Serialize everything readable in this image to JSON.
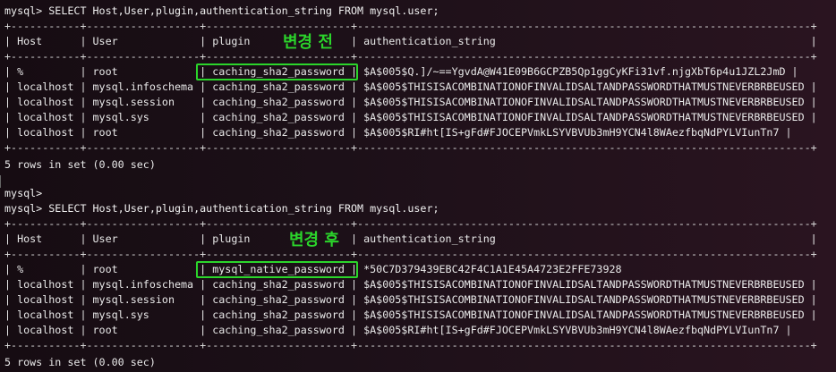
{
  "session1": {
    "query": "mysql> SELECT Host,User,plugin,authentication_string FROM mysql.user;",
    "border": "+-----------+------------------+-----------------------+------------------------------------------------------------------------+",
    "header": "| Host      | User             | plugin                | authentication_string                                                  |",
    "rows": [
      "| %         | root             | caching_sha2_password | $A$005$Q.]/~==YgvdA@W41E09B6GCPZB5Qp1ggCyKFi31vf.njgXbT6p4u1JZL2JmD |",
      "| localhost | mysql.infoschema | caching_sha2_password | $A$005$THISISACOMBINATIONOFINVALIDSALTANDPASSWORDTHATMUSTNEVERBRBEUSED |",
      "| localhost | mysql.session    | caching_sha2_password | $A$005$THISISACOMBINATIONOFINVALIDSALTANDPASSWORDTHATMUSTNEVERBRBEUSED |",
      "| localhost | mysql.sys        | caching_sha2_password | $A$005$THISISACOMBINATIONOFINVALIDSALTANDPASSWORDTHATMUSTNEVERBRBEUSED |",
      "| localhost | root             | caching_sha2_password | $A$005$RI#ht[IS+gFd#FJOCEPVmkLSYVBVUb3mH9YCN4l8WAezfbqNdPYLVIunTn7 |"
    ],
    "summary": "5 rows in set (0.00 sec)",
    "annotation": "변경 전"
  },
  "blank_prompt": "mysql>",
  "session2": {
    "query": "mysql> SELECT Host,User,plugin,authentication_string FROM mysql.user;",
    "border": "+-----------+------------------+-----------------------+------------------------------------------------------------------------+",
    "header": "| Host      | User             | plugin                | authentication_string                                                  |",
    "rows": [
      "| %         | root             | mysql_native_password | *50C7D379439EBC42F4C1A1E45A4723E2FFE73928",
      "| localhost | mysql.infoschema | caching_sha2_password | $A$005$THISISACOMBINATIONOFINVALIDSALTANDPASSWORDTHATMUSTNEVERBRBEUSED |",
      "| localhost | mysql.session    | caching_sha2_password | $A$005$THISISACOMBINATIONOFINVALIDSALTANDPASSWORDTHATMUSTNEVERBRBEUSED |",
      "| localhost | mysql.sys        | caching_sha2_password | $A$005$THISISACOMBINATIONOFINVALIDSALTANDPASSWORDTHATMUSTNEVERBRBEUSED |",
      "| localhost | root             | caching_sha2_password | $A$005$RI#ht[IS+gFd#FJOCEPVmkLSYVBVUb3mH9YCN4l8WAezfbqNdPYLVIunTn7 |"
    ],
    "summary": "5 rows in set (0.00 sec)",
    "annotation": "변경 후"
  },
  "colors": {
    "highlight": "#2bd52b",
    "background": "#1a0f16",
    "text": "#e9e9e9"
  }
}
